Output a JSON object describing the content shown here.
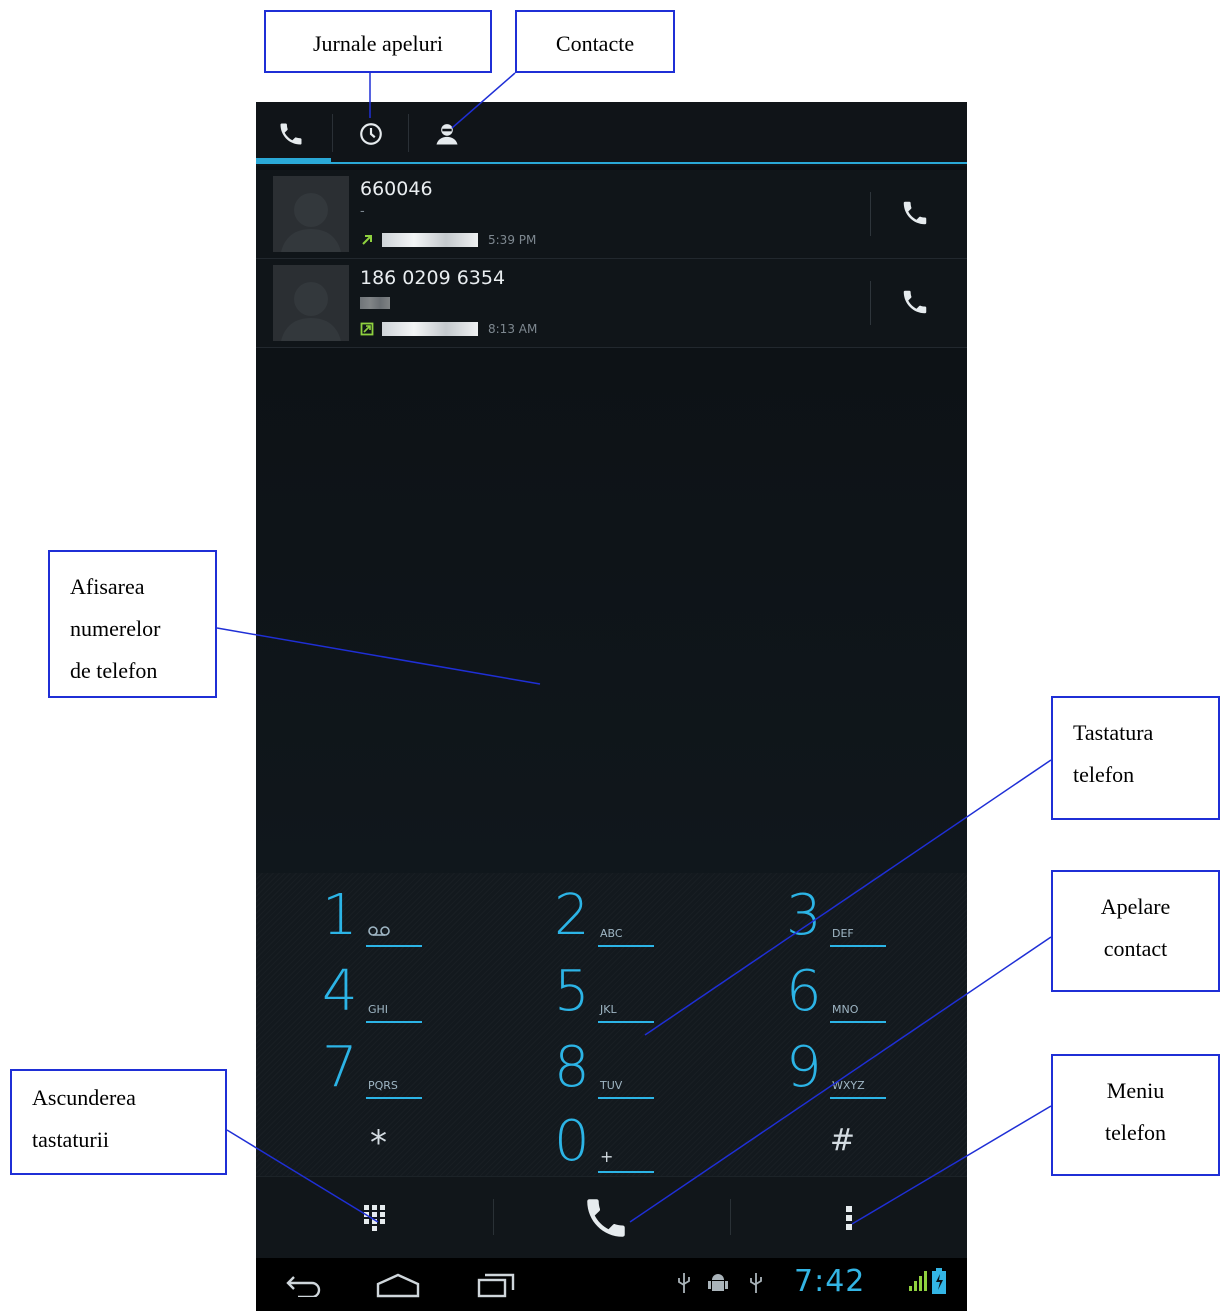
{
  "annotations": {
    "call_logs": "Jurnale apeluri",
    "contacts": "Contacte",
    "display": [
      "Afisarea",
      "numerelor",
      "de telefon"
    ],
    "keypad": [
      "Tastatura",
      "telefon"
    ],
    "call_contact": [
      "Apelare",
      "contact"
    ],
    "hide_keypad": [
      "Ascunderea",
      "tastaturii"
    ],
    "menu": [
      "Meniu",
      "telefon"
    ]
  },
  "tabs": [
    {
      "icon": "phone-icon",
      "selected": true
    },
    {
      "icon": "clock-icon",
      "selected": false
    },
    {
      "icon": "contact-icon",
      "selected": false
    }
  ],
  "call_log": [
    {
      "number": "660046",
      "subtitle": "-",
      "call_type": "outgoing",
      "time": "5:39 PM"
    },
    {
      "number": "186 0209 6354",
      "subtitle": "",
      "call_type": "forwarded",
      "time": "8:13 AM"
    }
  ],
  "keypad": [
    {
      "digit": "1",
      "letters": "voicemail-icon"
    },
    {
      "digit": "2",
      "letters": "ABC"
    },
    {
      "digit": "3",
      "letters": "DEF"
    },
    {
      "digit": "4",
      "letters": "GHI"
    },
    {
      "digit": "5",
      "letters": "JKL"
    },
    {
      "digit": "6",
      "letters": "MNO"
    },
    {
      "digit": "7",
      "letters": "PQRS"
    },
    {
      "digit": "8",
      "letters": "TUV"
    },
    {
      "digit": "9",
      "letters": "WXYZ"
    },
    {
      "digit": "*",
      "letters": ""
    },
    {
      "digit": "0",
      "letters": "+"
    },
    {
      "digit": "#",
      "letters": ""
    }
  ],
  "action_bar": {
    "left_icon": "dialpad-icon",
    "center_icon": "phone-icon",
    "right_icon": "overflow-menu-icon"
  },
  "status_bar": {
    "time": "7:42"
  },
  "colors": {
    "accent": "#33b5e5",
    "callout_border": "#1f2fd6",
    "outgoing_arrow": "#8fd13f"
  }
}
